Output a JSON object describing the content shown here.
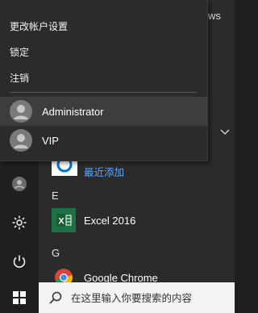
{
  "start_menu": {
    "top_right_text": "ws",
    "recent_label": "最近添加",
    "sections": [
      {
        "letter": "E",
        "apps": [
          {
            "label": "Excel 2016",
            "icon": "excel-icon"
          }
        ]
      },
      {
        "letter": "G",
        "apps": [
          {
            "label": "Google Chrome",
            "icon": "chrome-icon"
          }
        ]
      }
    ]
  },
  "account_flyout": {
    "items": [
      {
        "label": "更改帐户设置"
      },
      {
        "label": "锁定"
      },
      {
        "label": "注销"
      }
    ],
    "users": [
      {
        "name": "Administrator",
        "active": true
      },
      {
        "name": "VIP",
        "active": false
      }
    ]
  },
  "left_rail": {
    "icons": [
      "user-icon",
      "settings-icon",
      "power-icon"
    ]
  },
  "taskbar": {
    "search_placeholder": "在这里输入你要搜索的内容"
  },
  "colors": {
    "accent_link": "#5aaaff",
    "excel_green": "#1e7145",
    "menu_bg": "#2b2b2b"
  }
}
